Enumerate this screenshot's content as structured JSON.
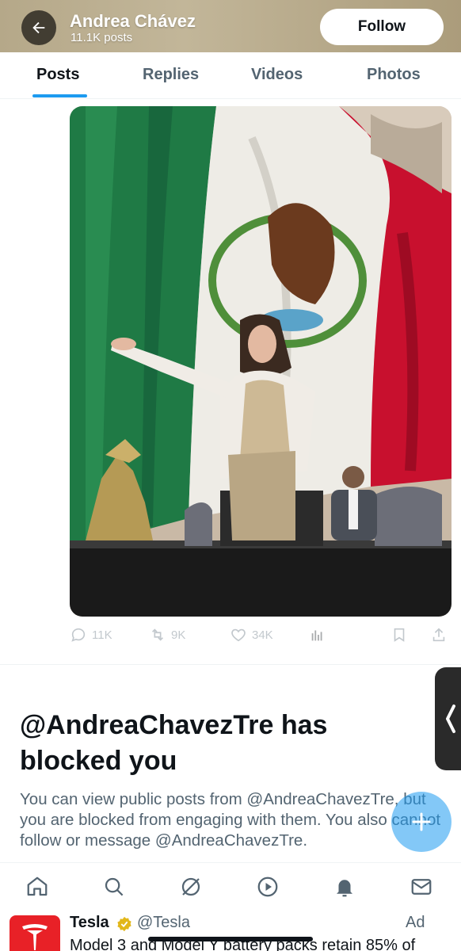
{
  "header": {
    "name": "Andrea Chávez",
    "post_count": "11.1K posts",
    "follow_label": "Follow"
  },
  "tabs": [
    {
      "label": "Posts",
      "active": true
    },
    {
      "label": "Replies",
      "active": false
    },
    {
      "label": "Videos",
      "active": false
    },
    {
      "label": "Photos",
      "active": false
    }
  ],
  "post": {
    "image_icon": "photo",
    "actions": {
      "replies": "11K",
      "reposts": "9K",
      "likes": "34K"
    }
  },
  "blocked_notice": {
    "title": "@AndreaChavezTre has blocked you",
    "body": "You can view public posts from @AndreaChavezTre, but you are blocked from engaging with them. You also cannot follow or message @AndreaChavezTre."
  },
  "bottom_nav": [
    "home-icon",
    "search-icon",
    "grok-icon",
    "video-icon",
    "notifications-icon",
    "messages-icon"
  ],
  "ad": {
    "name": "Tesla",
    "handle": "@Tesla",
    "label": "Ad",
    "text": "Model 3 and Model Y battery packs retain 85% of"
  },
  "colors": {
    "accent": "#1d9bf0",
    "header_bg": "#b5a889",
    "muted_text": "#536471",
    "tesla_red": "#e82127"
  }
}
